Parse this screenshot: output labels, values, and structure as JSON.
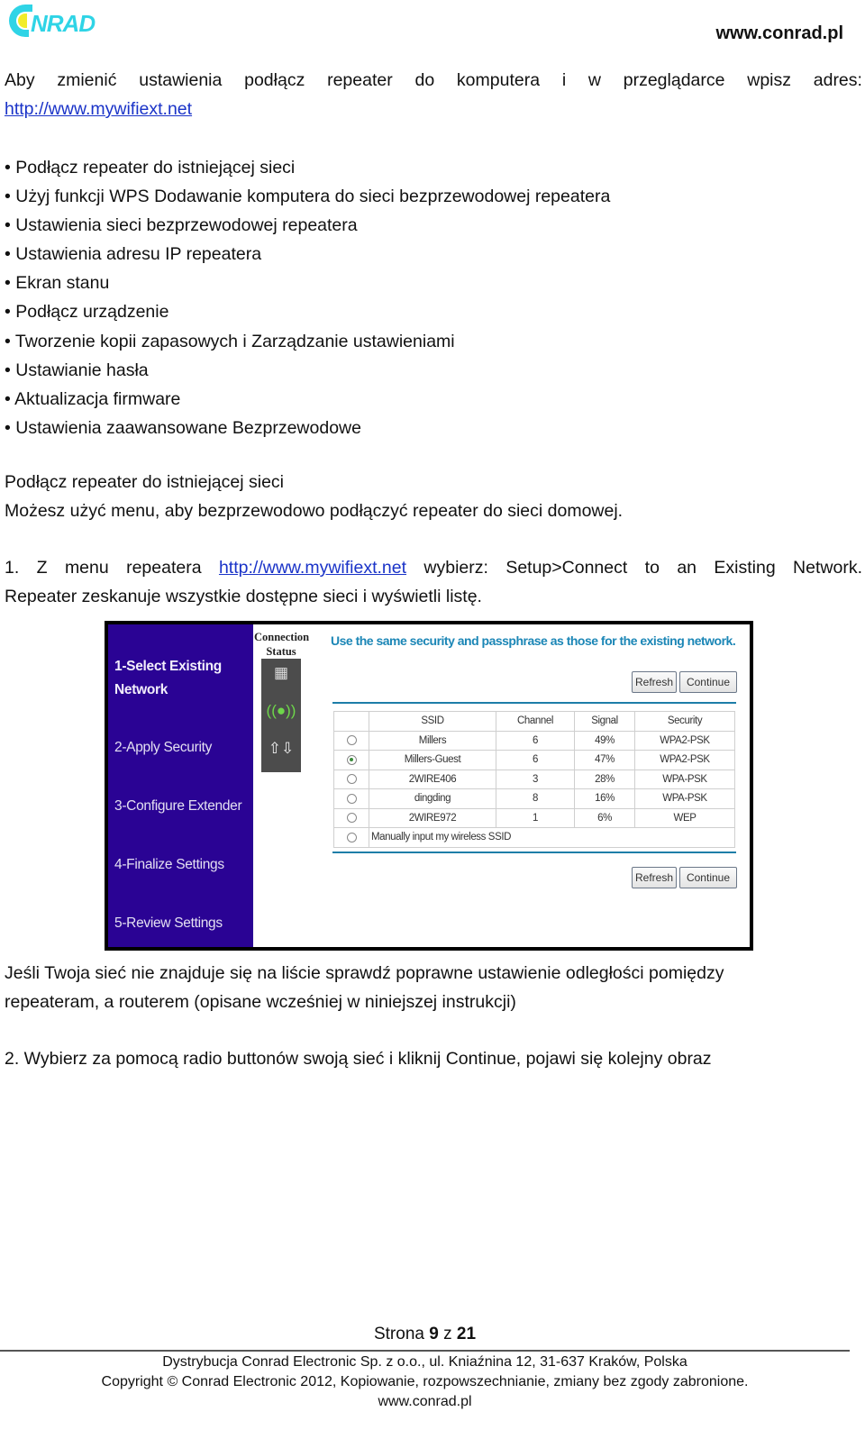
{
  "header": {
    "logo_text": "CONRAD",
    "website": "www.conrad.pl"
  },
  "colors": {
    "logo_cyan": "#2fd4e6",
    "logo_yellow": "#f2ec2a",
    "link": "#1a33c8",
    "wizard_sidebar": "#2a0394",
    "wizard_note": "#1b86b6"
  },
  "intro": {
    "words": [
      "Aby",
      "zmienić",
      "ustawienia",
      "podłącz",
      "repeater",
      "do",
      "komputera",
      "i",
      "w",
      "przeglądarce",
      "wpisz",
      "adres:"
    ],
    "link": "http://www.mywifiext.net"
  },
  "bullets": [
    "• Podłącz repeater do istniejącej sieci",
    "• Użyj funkcji WPS Dodawanie komputera do sieci bezprzewodowej repeatera",
    "• Ustawienia sieci bezprzewodowej repeatera",
    "• Ustawienia adresu IP repeatera",
    "• Ekran stanu",
    "• Podłącz urządzenie",
    "• Tworzenie kopii zapasowych i Zarządzanie ustawieniami",
    "• Ustawianie hasła",
    "• Aktualizacja firmware",
    "• Ustawienia zaawansowane Bezprzewodowe"
  ],
  "section": {
    "heading": "Podłącz repeater do istniejącej sieci",
    "subtext": "Możesz użyć menu, aby bezprzewodowo podłączyć repeater do sieci domowej."
  },
  "step1": {
    "before_link_words": [
      "1.",
      "Z",
      "menu",
      "repeatera"
    ],
    "link": "http://www.mywifiext.net",
    "after_link_words": [
      "wybierz:",
      "Setup>Connect",
      "to",
      "an",
      "Existing",
      "Network."
    ],
    "line2": "Repeater zeskanuje wszystkie dostępne sieci i wyświetli listę."
  },
  "wizard": {
    "steps": [
      {
        "label": "1-Select Existing Network",
        "active": true
      },
      {
        "label": "2-Apply Security",
        "active": false
      },
      {
        "label": "3-Configure Extender",
        "active": false
      },
      {
        "label": "4-Finalize Settings",
        "active": false
      },
      {
        "label": "5-Review Settings",
        "active": false
      }
    ],
    "connection_status_label": "Connection Status",
    "status_icons": [
      "router-icon",
      "wireless-signal-icon",
      "upload-download-icon"
    ],
    "note": "Use the same security and passphrase as those for the existing network.",
    "refresh_label": "Refresh",
    "continue_label": "Continue",
    "table": {
      "headers": [
        "",
        "SSID",
        "Channel",
        "Signal",
        "Security"
      ],
      "rows": [
        {
          "selected": false,
          "ssid": "Millers",
          "channel": "6",
          "signal": "49%",
          "security": "WPA2-PSK"
        },
        {
          "selected": true,
          "ssid": "Millers-Guest",
          "channel": "6",
          "signal": "47%",
          "security": "WPA2-PSK"
        },
        {
          "selected": false,
          "ssid": "2WIRE406",
          "channel": "3",
          "signal": "28%",
          "security": "WPA-PSK"
        },
        {
          "selected": false,
          "ssid": "dingding",
          "channel": "8",
          "signal": "16%",
          "security": "WPA-PSK"
        },
        {
          "selected": false,
          "ssid": "2WIRE972",
          "channel": "1",
          "signal": "6%",
          "security": "WEP"
        }
      ],
      "manual_option": "Manually input my wireless SSID"
    }
  },
  "after_image": {
    "para_line1": "Jeśli Twoja sieć nie znajduje się na liście sprawdź poprawne ustawienie odległości pomiędzy",
    "para_line2": "repeateram, a routerem (opisane wcześniej w niniejszej instrukcji)",
    "step2": "2. Wybierz za pomocą radio buttonów swoją sieć i kliknij Continue, pojawi się kolejny obraz"
  },
  "footer": {
    "page_prefix": "Strona",
    "page_current": "9",
    "page_sep": "z",
    "page_total": "21",
    "line1": "Dystrybucja Conrad Electronic Sp. z o.o., ul. Kniaźnina 12, 31-637 Kraków, Polska",
    "line2": "Copyright © Conrad Electronic 2012, Kopiowanie, rozpowszechnianie, zmiany bez zgody zabronione.",
    "line3": "www.conrad.pl"
  }
}
